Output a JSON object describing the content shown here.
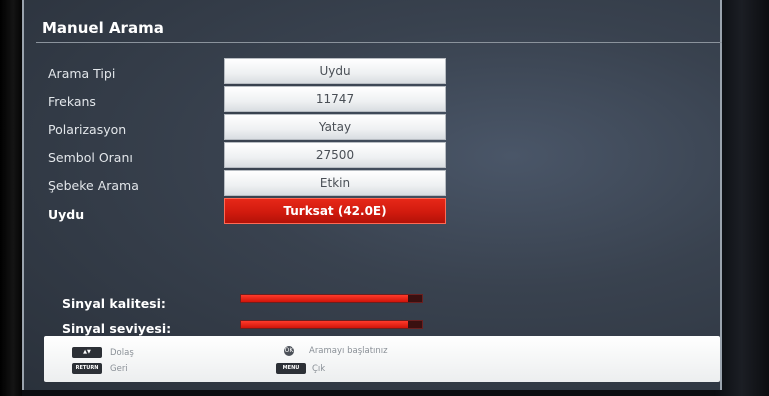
{
  "title": "Manuel Arama",
  "rows": [
    {
      "label": "Arama Tipi",
      "value": "Uydu"
    },
    {
      "label": "Frekans",
      "value": "11747"
    },
    {
      "label": "Polarizasyon",
      "value": "Yatay"
    },
    {
      "label": "Sembol Oranı",
      "value": "27500"
    },
    {
      "label": "Şebeke Arama",
      "value": "Etkin"
    },
    {
      "label": "Uydu",
      "value": "Turksat (42.0E)"
    }
  ],
  "signal": {
    "quality_label": "Sinyal kalitesi:",
    "quality_level": 0.92,
    "level_label": "Sinyal seviyesi:",
    "level_level": 0.92
  },
  "footer": {
    "nav_key": "▲▼",
    "nav_label": "Dolaş",
    "back_key": "RETURN",
    "back_label": "Geri",
    "ok_key": "OK",
    "ok_label": "Aramayı başlatınız",
    "menu_key": "MENU",
    "menu_label": "Çık"
  },
  "colors": {
    "accent": "#d11a0e",
    "background": "#39424f"
  }
}
